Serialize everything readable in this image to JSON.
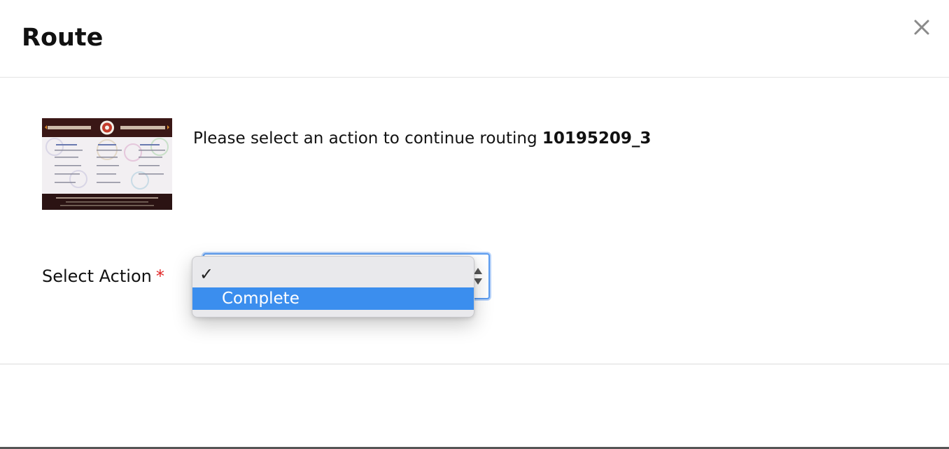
{
  "modal": {
    "title": "Route",
    "close_icon": "close-icon"
  },
  "content": {
    "prompt_text": "Please select an action to continue routing ",
    "route_id": "10195209_3",
    "thumbnail_icon": "menu-thumbnail-image"
  },
  "form": {
    "field_label": "Select Action",
    "required_mark": "*",
    "select": {
      "selected_value": "",
      "options": [
        {
          "label": "",
          "checked": true,
          "highlighted": false
        },
        {
          "label": "Complete",
          "checked": false,
          "highlighted": true
        }
      ]
    },
    "check_glyph": "✓"
  },
  "colors": {
    "accent": "#3b8eee",
    "required": "#e02424",
    "focus_border": "#5b9cf0"
  }
}
